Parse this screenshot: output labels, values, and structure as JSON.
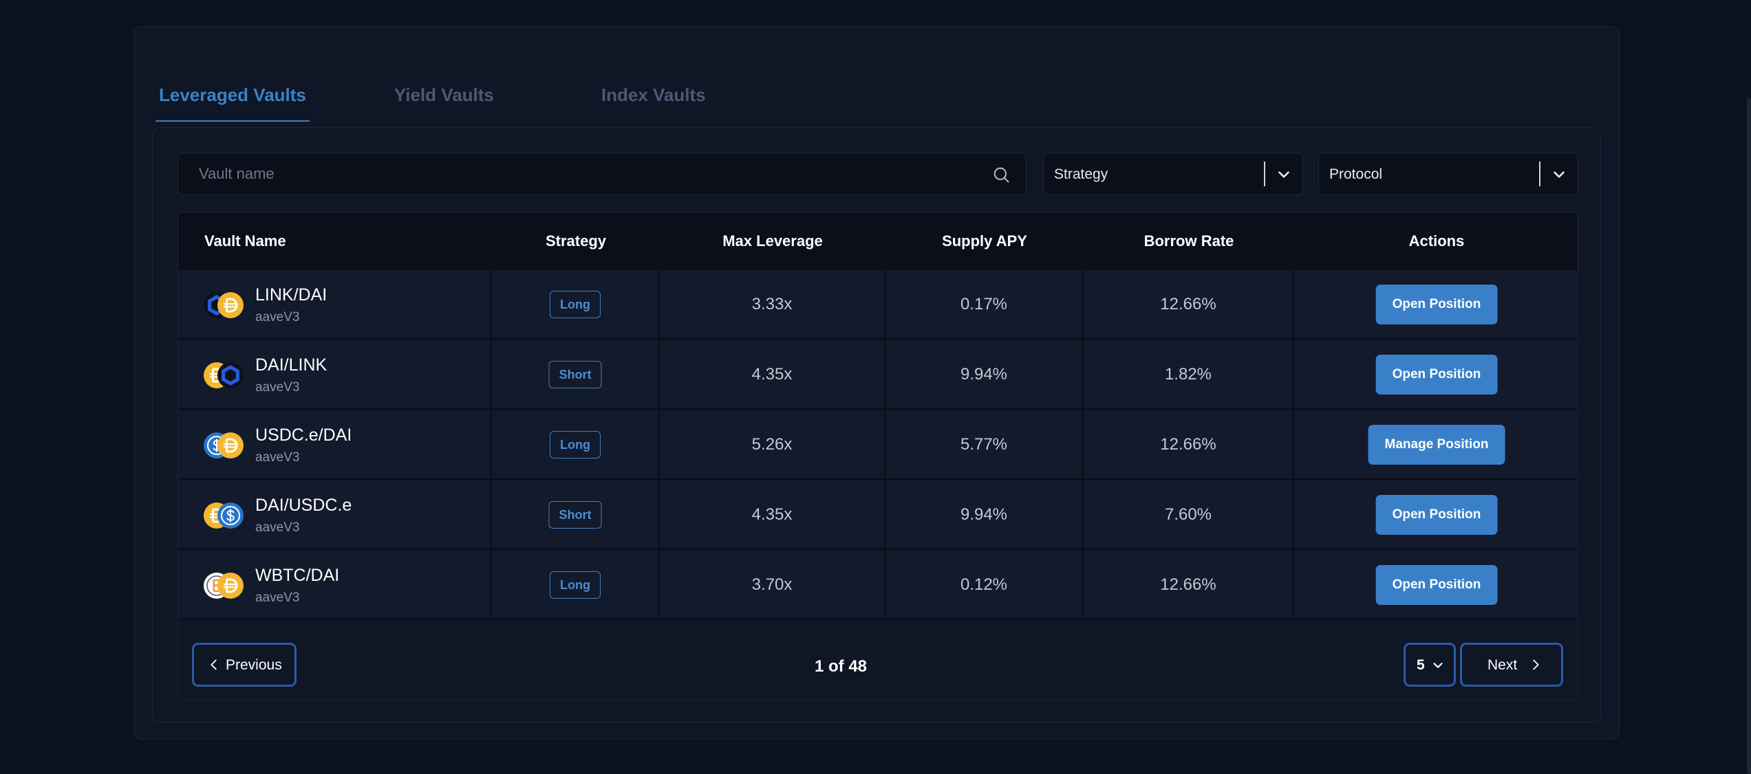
{
  "tabs": [
    {
      "label": "Leveraged Vaults",
      "active": true
    },
    {
      "label": "Yield Vaults",
      "active": false
    },
    {
      "label": "Index Vaults",
      "active": false
    }
  ],
  "filters": {
    "search_placeholder": "Vault name",
    "strategy_label": "Strategy",
    "protocol_label": "Protocol"
  },
  "table": {
    "headers": {
      "vault_name": "Vault Name",
      "strategy": "Strategy",
      "max_leverage": "Max Leverage",
      "supply_apy": "Supply APY",
      "borrow_rate": "Borrow Rate",
      "actions": "Actions"
    },
    "rows": [
      {
        "name": "LINK/DAI",
        "protocol": "aaveV3",
        "tokens": [
          "link",
          "dai"
        ],
        "strategy": "Long",
        "max_leverage": "3.33x",
        "supply_apy": "0.17%",
        "borrow_rate": "12.66%",
        "action": "Open Position"
      },
      {
        "name": "DAI/LINK",
        "protocol": "aaveV3",
        "tokens": [
          "dai",
          "link"
        ],
        "strategy": "Short",
        "max_leverage": "4.35x",
        "supply_apy": "9.94%",
        "borrow_rate": "1.82%",
        "action": "Open Position"
      },
      {
        "name": "USDC.e/DAI",
        "protocol": "aaveV3",
        "tokens": [
          "usdc",
          "dai"
        ],
        "strategy": "Long",
        "max_leverage": "5.26x",
        "supply_apy": "5.77%",
        "borrow_rate": "12.66%",
        "action": "Manage Position"
      },
      {
        "name": "DAI/USDC.e",
        "protocol": "aaveV3",
        "tokens": [
          "dai",
          "usdc"
        ],
        "strategy": "Short",
        "max_leverage": "4.35x",
        "supply_apy": "9.94%",
        "borrow_rate": "7.60%",
        "action": "Open Position"
      },
      {
        "name": "WBTC/DAI",
        "protocol": "aaveV3",
        "tokens": [
          "wbtc",
          "dai"
        ],
        "strategy": "Long",
        "max_leverage": "3.70x",
        "supply_apy": "0.12%",
        "borrow_rate": "12.66%",
        "action": "Open Position"
      }
    ]
  },
  "pagination": {
    "previous_label": "Previous",
    "page_text": "1 of 48",
    "page_size": "5",
    "next_label": "Next"
  },
  "colors": {
    "accent": "#3c82c6",
    "background": "#0b111d",
    "panel": "#0f1626",
    "row": "#121a2b"
  }
}
